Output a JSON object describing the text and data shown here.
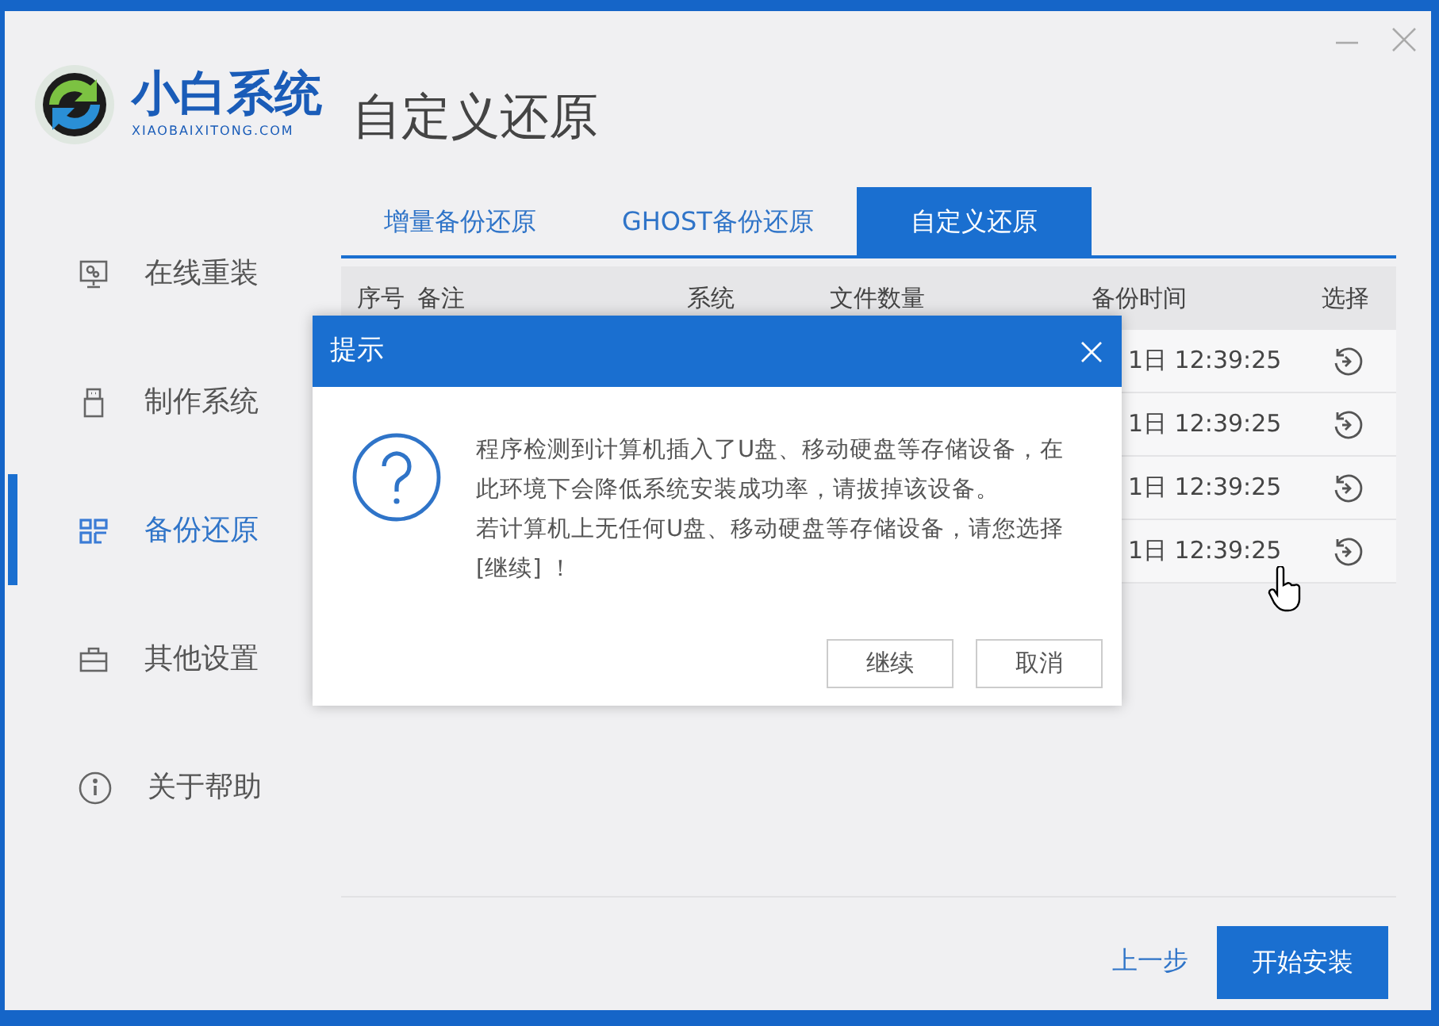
{
  "logo": {
    "name": "小白系统",
    "domain": "XIAOBAIXITONG.COM"
  },
  "page_title": "自定义还原",
  "sidebar": {
    "items": [
      {
        "label": "在线重装",
        "selected": false
      },
      {
        "label": "制作系统",
        "selected": false
      },
      {
        "label": "备份还原",
        "selected": true
      },
      {
        "label": "其他设置",
        "selected": false
      },
      {
        "label": "关于帮助",
        "selected": false
      }
    ]
  },
  "tabs": [
    {
      "label": "增量备份还原",
      "selected": false
    },
    {
      "label": "GHOST备份还原",
      "selected": false
    },
    {
      "label": "自定义还原",
      "selected": true
    }
  ],
  "table": {
    "columns": [
      "序号",
      "备注",
      "系统",
      "文件数量",
      "备份时间",
      "选择"
    ],
    "rows": [
      {
        "backup_time": "1日 12:39:25"
      },
      {
        "backup_time": "1日 12:39:25"
      },
      {
        "backup_time": "1日 12:39:25"
      },
      {
        "backup_time": "1日 12:39:25"
      }
    ]
  },
  "dialog": {
    "title": "提示",
    "message_lines": [
      "程序检测到计算机插入了U盘、移动硬盘等存储设备，在",
      "此环境下会降低系统安装成功率，请拔掉该设备。",
      "若计算机上无任何U盘、移动硬盘等存储设备，请您选择",
      "[继续] ！"
    ],
    "buttons": [
      "继续",
      "取消"
    ]
  },
  "footer": {
    "back": "上一步",
    "start": "开始安装"
  }
}
